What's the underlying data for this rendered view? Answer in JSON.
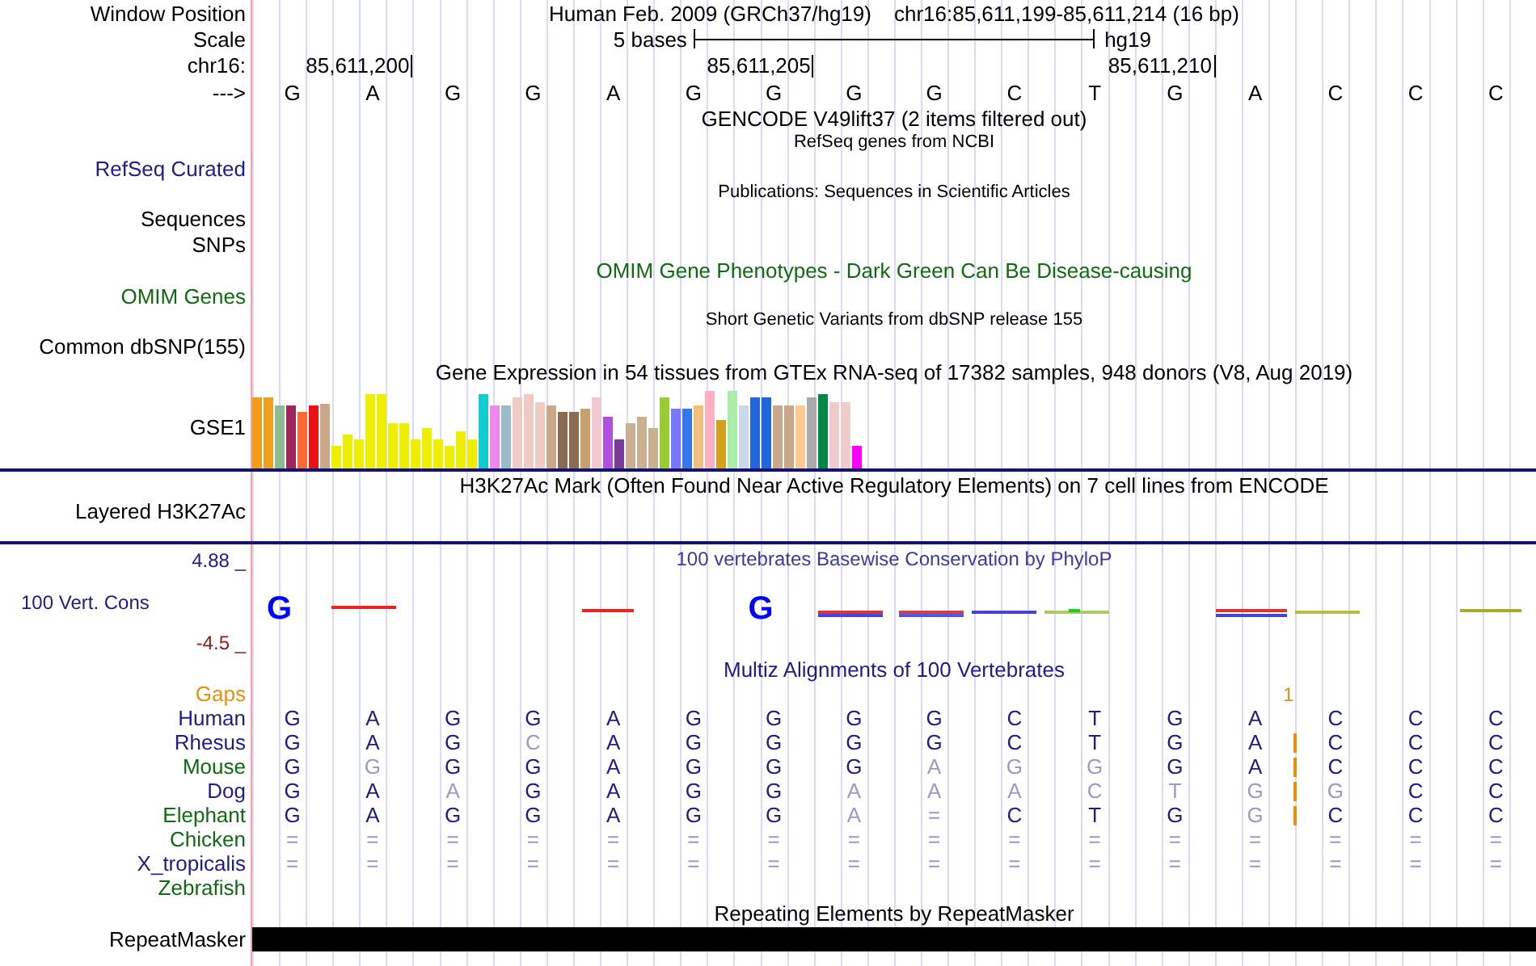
{
  "header": {
    "label": "Window Position",
    "assembly": "Human Feb. 2009 (GRCh37/hg19)",
    "range": "chr16:85,611,199-85,611,214 (16 bp)"
  },
  "scale": {
    "label": "Scale",
    "length": "5 bases",
    "assembly": "hg19"
  },
  "ruler": {
    "label": "chr16:",
    "ticks": [
      "85,611,200",
      "85,611,205",
      "85,611,210"
    ]
  },
  "sequence": {
    "label": "--->",
    "bases": [
      "G",
      "A",
      "G",
      "G",
      "A",
      "G",
      "G",
      "G",
      "G",
      "C",
      "T",
      "G",
      "A",
      "C",
      "C",
      "C"
    ]
  },
  "tracks": [
    {
      "kind": "title",
      "text": "GENCODE V49lift37 (2 items filtered out)"
    },
    {
      "kind": "subtitle",
      "text": "RefSeq genes from NCBI"
    },
    {
      "kind": "label",
      "text": "RefSeq Curated",
      "color": "#1c1c8a"
    },
    {
      "kind": "subtitle",
      "text": "Publications: Sequences in Scientific Articles"
    },
    {
      "kind": "label",
      "text": "Sequences",
      "color": "#000000"
    },
    {
      "kind": "label",
      "text": "SNPs",
      "color": "#000000"
    },
    {
      "kind": "title",
      "text": "OMIM Gene Phenotypes - Dark Green Can Be Disease-causing",
      "color": "#0f6b0f"
    },
    {
      "kind": "label",
      "text": "OMIM Genes",
      "color": "#0f6b0f"
    },
    {
      "kind": "subtitle",
      "text": "Short Genetic Variants from dbSNP release 155"
    },
    {
      "kind": "label",
      "text": "Common dbSNP(155)",
      "color": "#000000"
    },
    {
      "kind": "title",
      "text": "Gene Expression in 54 tissues from GTEx RNA-seq of 17382 samples, 948 donors (V8, Aug 2019)"
    },
    {
      "kind": "expression",
      "text": "GSE1"
    },
    {
      "kind": "title",
      "text": "H3K27Ac Mark (Often Found Near Active Regulatory Elements) on 7 cell lines from ENCODE"
    },
    {
      "kind": "layered",
      "text": "Layered H3K27Ac"
    },
    {
      "kind": "conservation",
      "text": "100 Vert. Cons",
      "title": "100 vertebrates Basewise Conservation by PhyloP",
      "max": "4.88 _",
      "min": "-4.5 _",
      "logo": [
        {
          "kind": "letter",
          "text": "G"
        },
        {
          "kind": "blank"
        },
        {
          "kind": "blank"
        },
        {
          "kind": "blank"
        },
        {
          "kind": "blank"
        },
        {
          "kind": "blank"
        },
        {
          "kind": "letter",
          "text": "G"
        },
        {
          "kind": "blank"
        },
        {
          "kind": "blank"
        },
        {
          "kind": "blank"
        },
        {
          "kind": "blank"
        },
        {
          "kind": "blank"
        },
        {
          "kind": "blank"
        },
        {
          "kind": "blank"
        },
        {
          "kind": "blank"
        },
        {
          "kind": "blank"
        }
      ]
    },
    {
      "kind": "title",
      "text": "Multiz Alignments of 100 Vertebrates",
      "color": "#1c1c8a"
    },
    {
      "kind": "gaps",
      "text": "Gaps",
      "marks": [
        {
          "kind": "blank"
        },
        {
          "kind": "blank"
        },
        {
          "kind": "blank"
        },
        {
          "kind": "blank"
        },
        {
          "kind": "blank"
        },
        {
          "kind": "blank"
        },
        {
          "kind": "blank"
        },
        {
          "kind": "blank"
        },
        {
          "kind": "blank"
        },
        {
          "kind": "blank"
        },
        {
          "kind": "blank"
        },
        {
          "kind": "blank"
        },
        {
          "kind": "count",
          "text": "1"
        },
        {
          "kind": "blank"
        },
        {
          "kind": "blank"
        },
        {
          "kind": "blank"
        }
      ]
    },
    {
      "kind": "species",
      "text": "Human",
      "color": "#1c1c8a",
      "bases": [
        "G",
        "A",
        "G",
        "G",
        "A",
        "G",
        "G",
        "G",
        "G",
        "C",
        "T",
        "G",
        "A",
        "C",
        "C",
        "C"
      ],
      "faded": [
        false,
        false,
        false,
        false,
        false,
        false,
        false,
        false,
        false,
        false,
        false,
        false,
        false,
        false,
        false,
        false
      ],
      "insert_marks": [
        false,
        false,
        false,
        false,
        false,
        false,
        false,
        false,
        false,
        false,
        false,
        false,
        false,
        false,
        false,
        false
      ]
    },
    {
      "kind": "species",
      "text": "Rhesus",
      "color": "#1c1c8a",
      "bases": [
        "G",
        "A",
        "G",
        "C",
        "A",
        "G",
        "G",
        "G",
        "G",
        "C",
        "T",
        "G",
        "A",
        "C",
        "C",
        "C"
      ],
      "faded": [
        false,
        false,
        false,
        true,
        false,
        false,
        false,
        false,
        false,
        false,
        false,
        false,
        false,
        false,
        false,
        false
      ],
      "insert_marks": [
        false,
        false,
        false,
        false,
        false,
        false,
        false,
        false,
        false,
        false,
        false,
        false,
        true,
        false,
        false,
        false
      ]
    },
    {
      "kind": "species",
      "text": "Mouse",
      "color": "#0f6b0f",
      "bases": [
        "G",
        "G",
        "G",
        "G",
        "A",
        "G",
        "G",
        "G",
        "A",
        "G",
        "G",
        "G",
        "A",
        "C",
        "C",
        "C"
      ],
      "faded": [
        false,
        true,
        false,
        false,
        false,
        false,
        false,
        false,
        true,
        true,
        true,
        false,
        false,
        false,
        false,
        false
      ],
      "insert_marks": [
        false,
        false,
        false,
        false,
        false,
        false,
        false,
        false,
        false,
        false,
        false,
        false,
        true,
        false,
        false,
        false
      ]
    },
    {
      "kind": "species",
      "text": "Dog",
      "color": "#1c1c8a",
      "bases": [
        "G",
        "A",
        "A",
        "G",
        "A",
        "G",
        "G",
        "A",
        "A",
        "A",
        "C",
        "T",
        "G",
        "G",
        "C",
        "C"
      ],
      "faded": [
        false,
        false,
        true,
        false,
        false,
        false,
        false,
        true,
        true,
        true,
        true,
        true,
        true,
        true,
        false,
        false
      ],
      "insert_marks": [
        false,
        false,
        false,
        false,
        false,
        false,
        false,
        false,
        false,
        false,
        false,
        false,
        true,
        false,
        false,
        false
      ]
    },
    {
      "kind": "species",
      "text": "Elephant",
      "color": "#0f6b0f",
      "bases": [
        "G",
        "A",
        "G",
        "G",
        "A",
        "G",
        "G",
        "A",
        "=",
        "C",
        "T",
        "G",
        "G",
        "C",
        "C",
        "C"
      ],
      "faded": [
        false,
        false,
        false,
        false,
        false,
        false,
        false,
        true,
        true,
        false,
        false,
        false,
        true,
        false,
        false,
        false
      ],
      "insert_marks": [
        false,
        false,
        false,
        false,
        false,
        false,
        false,
        false,
        false,
        false,
        false,
        false,
        true,
        false,
        false,
        false
      ]
    },
    {
      "kind": "species",
      "text": "Chicken",
      "color": "#0f6b0f",
      "bases": [
        "=",
        "=",
        "=",
        "=",
        "=",
        "=",
        "=",
        "=",
        "=",
        "=",
        "=",
        "=",
        "=",
        "=",
        "=",
        "="
      ],
      "faded": [
        true,
        true,
        true,
        true,
        true,
        true,
        true,
        true,
        true,
        true,
        true,
        true,
        true,
        true,
        true,
        true
      ],
      "insert_marks": [
        false,
        false,
        false,
        false,
        false,
        false,
        false,
        false,
        false,
        false,
        false,
        false,
        false,
        false,
        false,
        false
      ]
    },
    {
      "kind": "species",
      "text": "X_tropicalis",
      "color": "#1c1c8a",
      "bases": [
        "=",
        "=",
        "=",
        "=",
        "=",
        "=",
        "=",
        "=",
        "=",
        "=",
        "=",
        "=",
        "=",
        "=",
        "=",
        "="
      ],
      "faded": [
        true,
        true,
        true,
        true,
        true,
        true,
        true,
        true,
        true,
        true,
        true,
        true,
        true,
        true,
        true,
        true
      ],
      "insert_marks": [
        false,
        false,
        false,
        false,
        false,
        false,
        false,
        false,
        false,
        false,
        false,
        false,
        false,
        false,
        false,
        false
      ]
    },
    {
      "kind": "species",
      "text": "Zebrafish",
      "color": "#0f6b0f"
    },
    {
      "kind": "title",
      "text": "Repeating Elements by RepeatMasker"
    },
    {
      "kind": "repeat",
      "text": "RepeatMasker"
    }
  ]
}
